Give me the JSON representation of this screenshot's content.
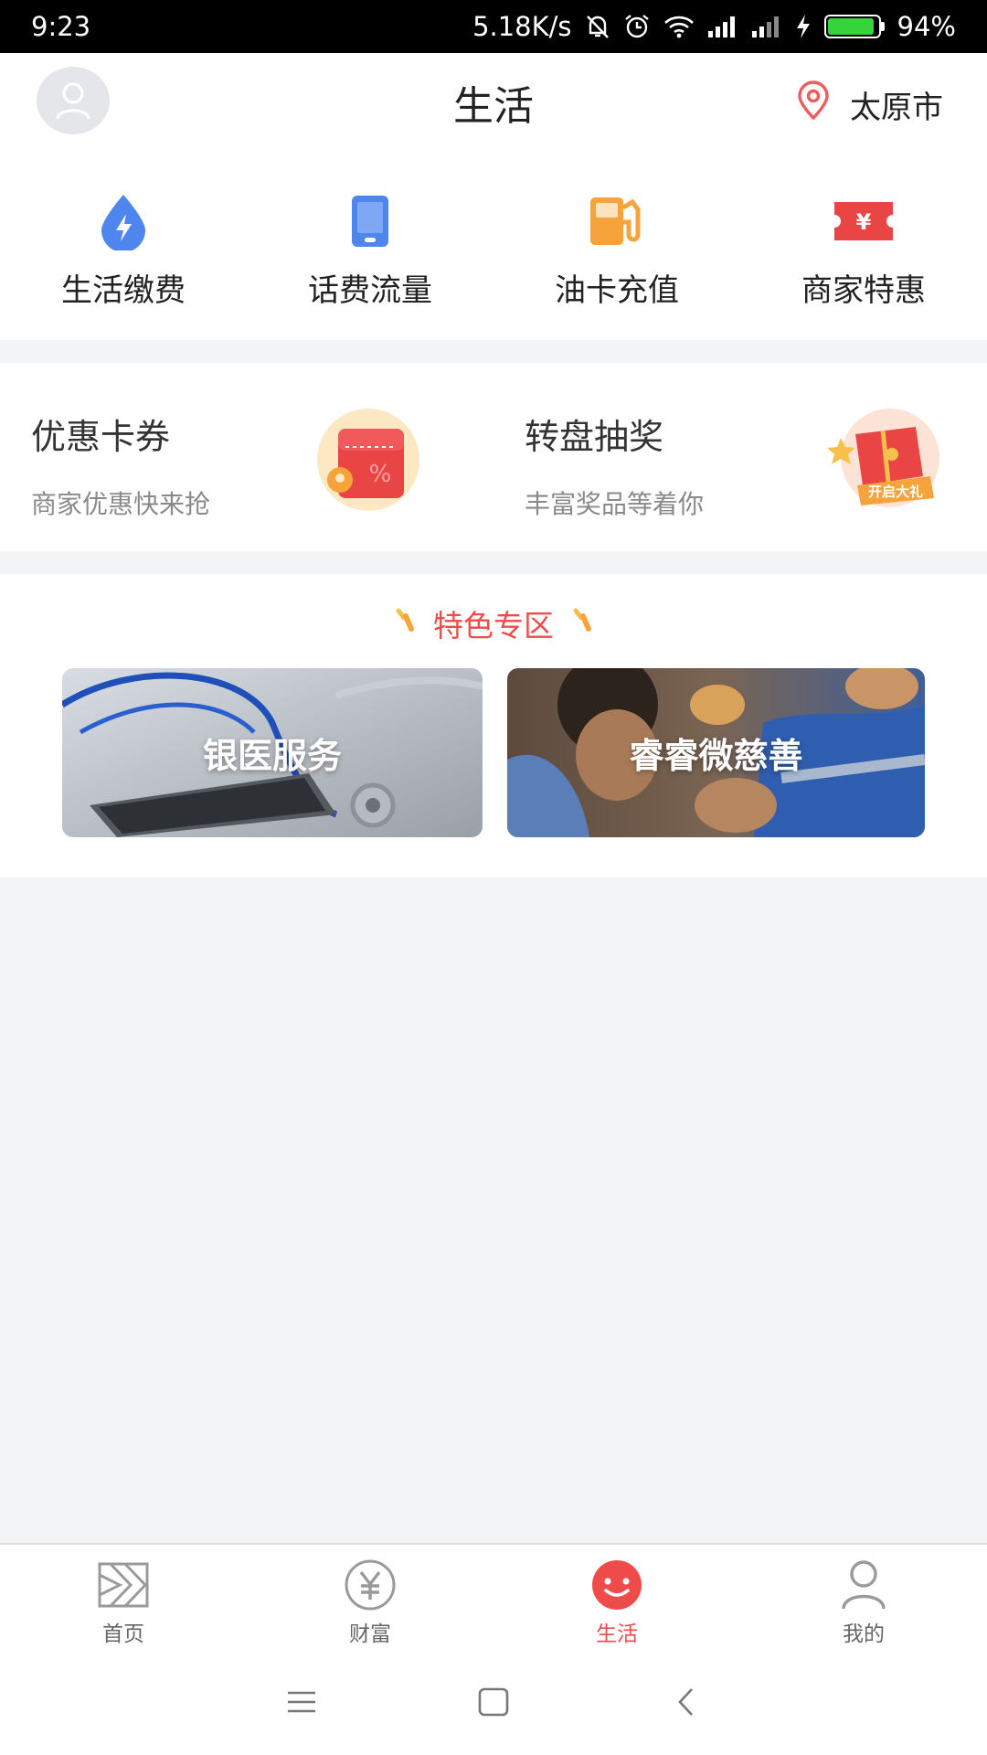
{
  "status_bar": {
    "time": "9:23",
    "net_speed": "5.18K/s",
    "battery_text": "94%",
    "battery_level": 0.94,
    "icons": [
      "mute-icon",
      "alarm-icon",
      "wifi-icon",
      "signal-icon",
      "signal-icon-2",
      "charging-icon",
      "battery-icon"
    ]
  },
  "header": {
    "title": "生活",
    "city": "太原市",
    "avatar_icon": "user-avatar-icon",
    "location_icon": "location-pin-icon"
  },
  "quick_services": [
    {
      "label": "生活缴费",
      "icon": "utility-payment-icon"
    },
    {
      "label": "话费流量",
      "icon": "mobile-topup-icon"
    },
    {
      "label": "油卡充值",
      "icon": "fuel-card-icon"
    },
    {
      "label": "商家特惠",
      "icon": "merchant-deal-icon"
    }
  ],
  "promos": [
    {
      "title": "优惠卡券",
      "subtitle": "商家优惠快来抢",
      "icon": "coupon-icon"
    },
    {
      "title": "转盘抽奖",
      "subtitle": "丰富奖品等着你",
      "icon": "gift-box-icon",
      "badge": "开启大礼"
    }
  ],
  "featured": {
    "title": "特色专区",
    "tiles": [
      {
        "label": "银医服务",
        "image": "stethoscope-phone-image"
      },
      {
        "label": "睿睿微慈善",
        "image": "children-eating-image"
      }
    ]
  },
  "tabbar": [
    {
      "label": "首页",
      "icon": "home-icon",
      "active": false
    },
    {
      "label": "财富",
      "icon": "yuan-icon",
      "active": false
    },
    {
      "label": "生活",
      "icon": "smile-icon",
      "active": true
    },
    {
      "label": "我的",
      "icon": "profile-icon",
      "active": false
    }
  ],
  "colors": {
    "accent": "#ef4b4b",
    "blue": "#4f86ee",
    "orange": "#f7a33c",
    "red": "#e94545"
  }
}
